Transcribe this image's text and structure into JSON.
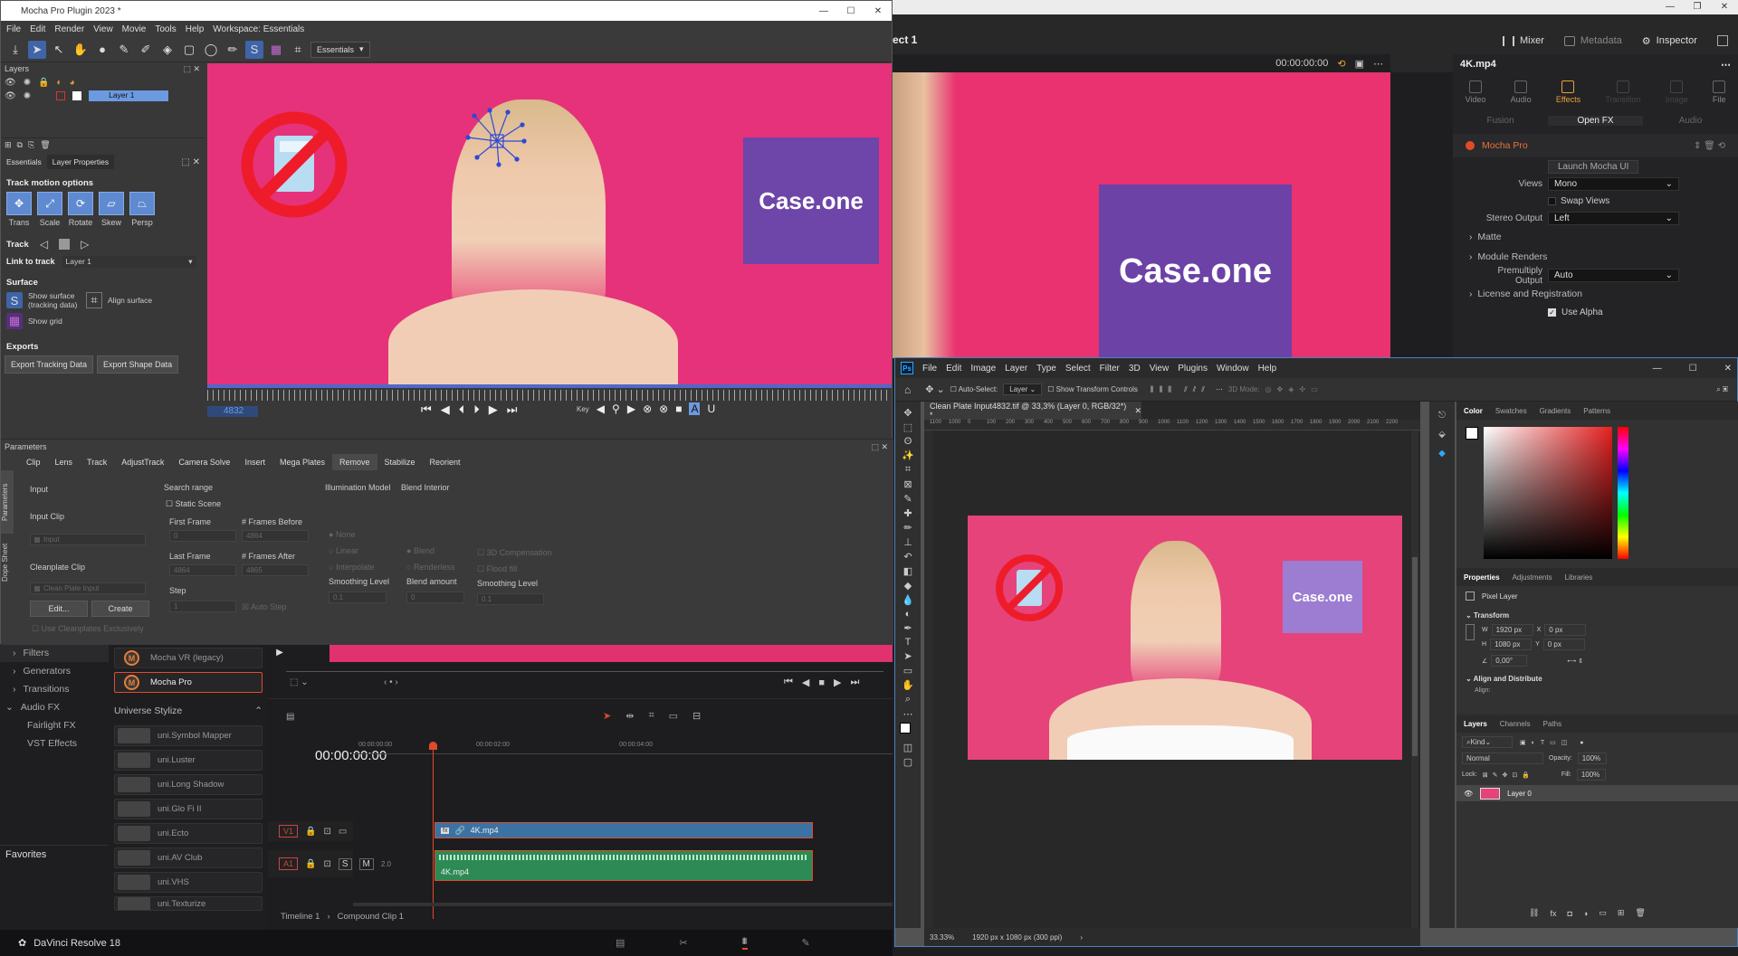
{
  "davinci": {
    "project_title": "ect 1",
    "toolbar": {
      "mixer": "Mixer",
      "metadata": "Metadata",
      "inspector": "Inspector"
    },
    "viewer_timecode": "00:00:00:00",
    "viewer_case_text": "Case.one",
    "inspector": {
      "clip_name": "4K.mp4",
      "tabs": [
        "Video",
        "Audio",
        "Effects",
        "Transition",
        "Image",
        "File"
      ],
      "sub_tabs": [
        "Fusion",
        "Open FX",
        "Audio"
      ],
      "effect_name": "Mocha Pro",
      "launch_btn": "Launch Mocha UI",
      "views_label": "Views",
      "views_value": "Mono",
      "swap_views": "Swap Views",
      "stereo_label": "Stereo Output",
      "stereo_value": "Left",
      "matte": "Matte",
      "module_renders": "Module Renders",
      "premult_label": "Premultiply Output",
      "premult_value": "Auto",
      "license": "License and Registration",
      "use_alpha": "Use Alpha"
    },
    "fx_tree": [
      "Filters",
      "Generators",
      "Transitions",
      "Audio FX",
      "Fairlight FX",
      "VST Effects"
    ],
    "favorites": "Favorites",
    "fx_list_top": [
      "Mocha VR (legacy)",
      "Mocha Pro"
    ],
    "universe_header": "Universe Stylize",
    "universe_items": [
      "uni.Symbol Mapper",
      "uni.Luster",
      "uni.Long Shadow",
      "uni.Glo Fi II",
      "uni.Ecto",
      "uni.AV Club",
      "uni.VHS",
      "uni.Texturize"
    ],
    "timeline": {
      "timecode": "00:00:00:00",
      "ruler": [
        "00:00:00:00",
        "00:00:02:00",
        "00:00:04:00"
      ],
      "v1": "V1",
      "a1": "A1",
      "a1_level": "2.0",
      "clip_video": "4K.mp4",
      "clip_audio": "4K.mp4",
      "breadcrumb": [
        "Timeline 1",
        "Compound Clip 1"
      ]
    },
    "app_name": "DaVinci Resolve 18"
  },
  "mocha": {
    "title": "Mocha Pro Plugin 2023 *",
    "menu": [
      "File",
      "Edit",
      "Render",
      "View",
      "Movie",
      "Tools",
      "Help",
      "Workspace: Essentials"
    ],
    "workspace_value": "Essentials",
    "layers_header": "Layers",
    "layer_name": "Layer 1",
    "panel_tabs": [
      "Essentials",
      "Layer Properties"
    ],
    "track_motion_header": "Track motion options",
    "track_motion": [
      "Trans",
      "Scale",
      "Rotate",
      "Skew",
      "Persp"
    ],
    "track_label": "Track",
    "link_label": "Link to track",
    "link_value": "Layer 1",
    "surface_header": "Surface",
    "show_surface": "Show surface (tracking data)",
    "align_surface": "Align surface",
    "show_grid": "Show grid",
    "exports_header": "Exports",
    "export_tracking": "Export Tracking Data",
    "export_shape": "Export Shape Data",
    "viewer_case_text": "Case.one",
    "frame": "4832",
    "key_label": "Key",
    "params_header": "Parameters",
    "param_tabs": [
      "Clip",
      "Lens",
      "Track",
      "AdjustTrack",
      "Camera Solve",
      "Insert",
      "Mega Plates",
      "Remove",
      "Stabilize",
      "Reorient"
    ],
    "side_tabs": [
      "Parameters",
      "Dope Sheet"
    ],
    "remove": {
      "input": "Input",
      "input_clip": "Input Clip",
      "input_value": "Input",
      "cleanplate_clip": "Cleanplate Clip",
      "cleanplate_value": "Clean Plate Input",
      "edit": "Edit...",
      "create": "Create",
      "use_cleanplates": "Use Cleanplates Exclusively",
      "search_range": "Search range",
      "static_scene": "Static Scene",
      "first_frame": "First Frame",
      "first_frame_val": "0",
      "frames_before": "# Frames Before",
      "frames_before_val": "4864",
      "last_frame": "Last Frame",
      "last_frame_val": "4864",
      "frames_after": "# Frames After",
      "frames_after_val": "4865",
      "step": "Step",
      "step_val": "1",
      "auto_step": "Auto Step",
      "illum_model": "Illumination Model",
      "illum_opts": [
        "None",
        "Linear",
        "Interpolate"
      ],
      "smoothing_level": "Smoothing Level",
      "smoothing_val": "0.1",
      "blend_interior": "Blend Interior",
      "blend_opts": [
        "Blend",
        "Renderless"
      ],
      "blend_amount": "Blend amount",
      "blend_amount_val": "0",
      "comp_opts": [
        "3D Compensation",
        "Flood fill"
      ],
      "smoothing_level2": "Smoothing Level",
      "smoothing_val2": "0.1"
    }
  },
  "photoshop": {
    "menu": [
      "File",
      "Edit",
      "Image",
      "Layer",
      "Type",
      "Select",
      "Filter",
      "3D",
      "View",
      "Plugins",
      "Window",
      "Help"
    ],
    "auto_select": "Auto-Select:",
    "auto_select_value": "Layer",
    "show_transform": "Show Transform Controls",
    "mode_3d": "3D Mode:",
    "doc_tab": "Clean Plate Input4832.tif @ 33,3% (Layer 0, RGB/32*) *",
    "ruler": [
      "1100",
      "1000",
      "0",
      "100",
      "200",
      "300",
      "400",
      "500",
      "600",
      "700",
      "800",
      "900",
      "1000",
      "1100",
      "1200",
      "1300",
      "1400",
      "1500",
      "1600",
      "1700",
      "1800",
      "1900",
      "2000",
      "2100",
      "2200"
    ],
    "canvas_case_text": "Case.one",
    "status_zoom": "33.33%",
    "status_info": "1920 px x 1080 px (300 ppi)",
    "color_tabs": [
      "Color",
      "Swatches",
      "Gradients",
      "Patterns"
    ],
    "props_tabs": [
      "Properties",
      "Adjustments",
      "Libraries"
    ],
    "pixel_layer": "Pixel Layer",
    "transform": "Transform",
    "w_val": "1920 px",
    "x_val": "0 px",
    "h_val": "1080 px",
    "y_val": "0 px",
    "angle_val": "0,00°",
    "align": "Align and Distribute",
    "align_label": "Align:",
    "layers_tabs": [
      "Layers",
      "Channels",
      "Paths"
    ],
    "kind": "Kind",
    "blend_mode": "Normal",
    "opacity_label": "Opacity:",
    "opacity_val": "100%",
    "lock_label": "Lock:",
    "fill_label": "Fill:",
    "fill_val": "100%",
    "layer_name": "Layer 0"
  }
}
